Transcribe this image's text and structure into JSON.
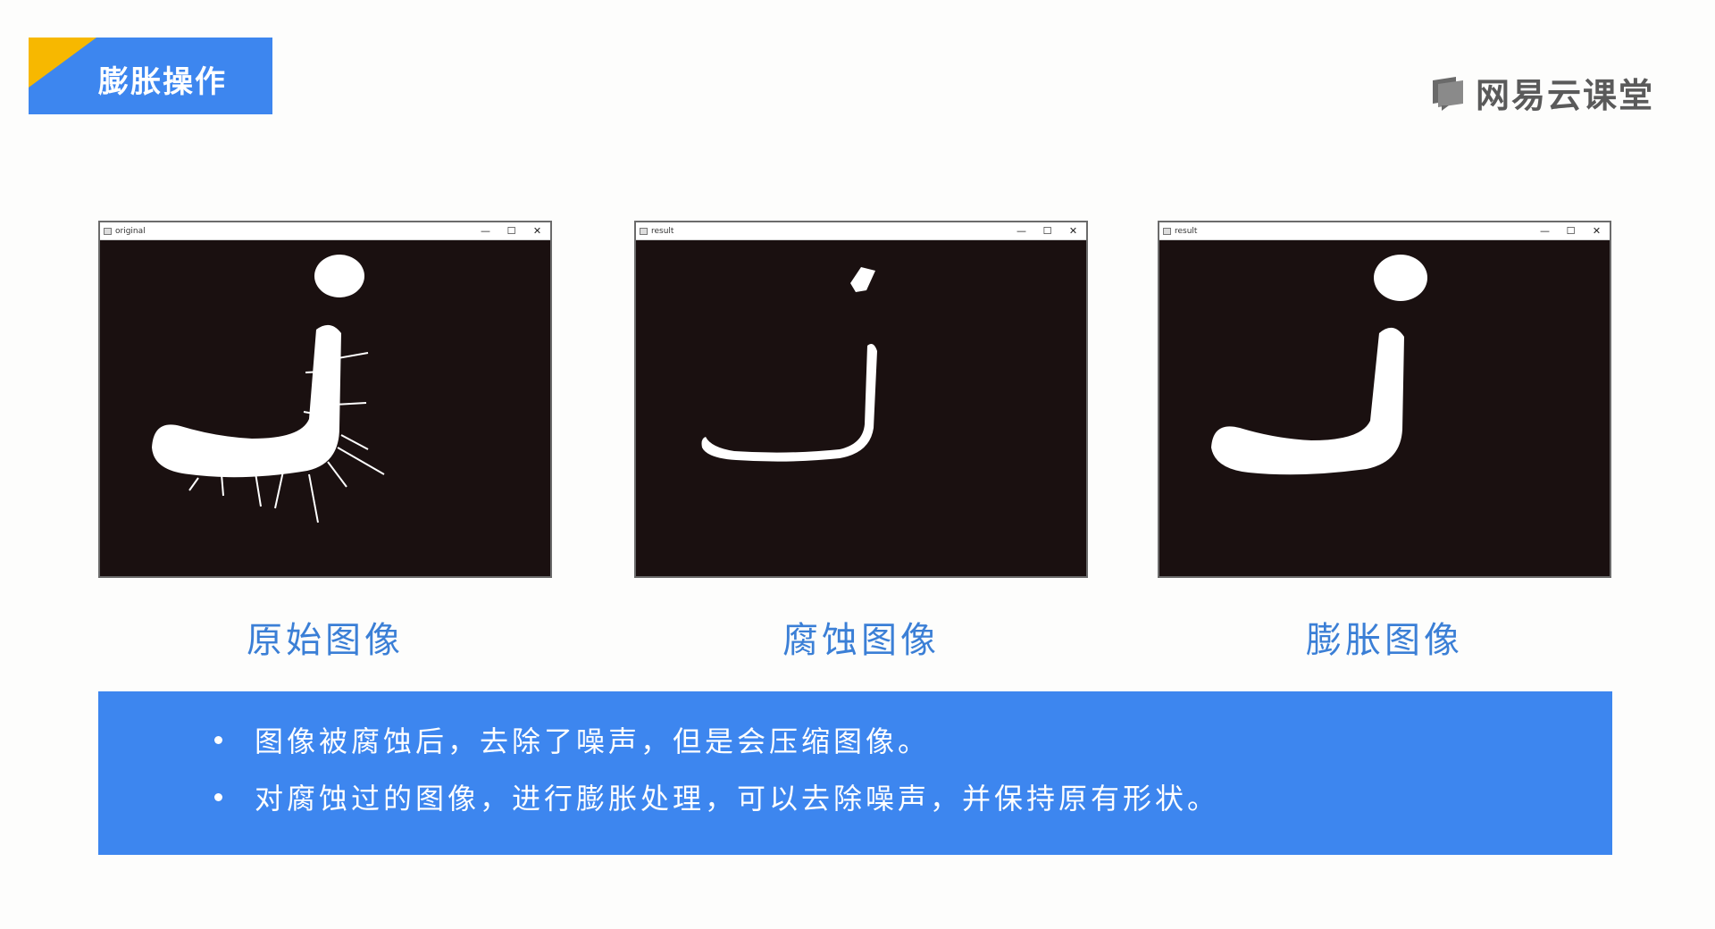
{
  "header": {
    "title": "膨胀操作",
    "brand": "网易云课堂",
    "brand_icon": "book-logo-icon"
  },
  "colors": {
    "accent_blue": "#3d86ef",
    "accent_yellow": "#f7b800",
    "caption_blue": "#3b7fd6",
    "image_background": "#1a1010"
  },
  "windows": [
    {
      "title": "original",
      "caption": "原始图像",
      "variant": "original"
    },
    {
      "title": "result",
      "caption": "腐蚀图像",
      "variant": "eroded"
    },
    {
      "title": "result",
      "caption": "膨胀图像",
      "variant": "dilated"
    }
  ],
  "window_controls": {
    "minimize": "—",
    "maximize": "☐",
    "close": "✕"
  },
  "notes": [
    "图像被腐蚀后，去除了噪声，但是会压缩图像。",
    "对腐蚀过的图像，进行膨胀处理，可以去除噪声，并保持原有形状。"
  ]
}
